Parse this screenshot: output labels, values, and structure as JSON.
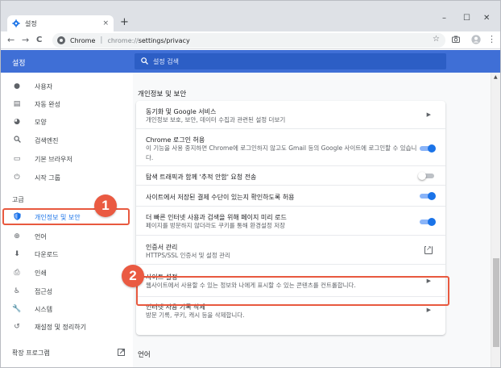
{
  "browser": {
    "tab_title": "설정",
    "tab_close": "×",
    "new_tab": "+",
    "minimize": "–",
    "maximize": "☐",
    "close": "✕",
    "back": "←",
    "forward": "→",
    "reload": "C",
    "host": "Chrome",
    "url_scheme": "chrome://",
    "url_path": "settings/privacy"
  },
  "header": {
    "title": "설정",
    "search_placeholder": "설정 검색"
  },
  "sidebar": {
    "items": [
      {
        "label": "사용자",
        "icon": "person-icon"
      },
      {
        "label": "자동 완성",
        "icon": "clipboard-icon"
      },
      {
        "label": "모양",
        "icon": "palette-icon"
      },
      {
        "label": "검색엔진",
        "icon": "search-icon"
      },
      {
        "label": "기본 브라우저",
        "icon": "browser-icon"
      },
      {
        "label": "시작 그룹",
        "icon": "power-icon"
      }
    ],
    "advanced_heading": "고급",
    "advanced_items": [
      {
        "label": "개인정보 및 보안",
        "icon": "shield-icon",
        "selected": true
      },
      {
        "label": "언어",
        "icon": "globe-icon"
      },
      {
        "label": "다운로드",
        "icon": "download-icon"
      },
      {
        "label": "인쇄",
        "icon": "printer-icon"
      },
      {
        "label": "접근성",
        "icon": "accessibility-icon"
      },
      {
        "label": "시스템",
        "icon": "wrench-icon"
      },
      {
        "label": "재설정 및 정리하기",
        "icon": "history-icon"
      }
    ],
    "extensions_label": "확장 프로그램"
  },
  "main": {
    "section_title": "개인정보 및 보안",
    "rows": [
      {
        "title": "동기화 및 Google 서비스",
        "subtitle": "개인정보 보호, 보안, 데이터 수집과 관련된 설정 더보기",
        "control": "arrow"
      },
      {
        "title": "Chrome 로그인 허용",
        "subtitle": "이 기능을 사용 중지하면 Chrome에 로그인하지 않고도 Gmail 등의 Google 사이트에 로그인할 수 있습니다.",
        "control": "toggle",
        "on": true
      },
      {
        "title": "탐색 트래픽과 함께 '추적 안함' 요청 전송",
        "control": "toggle",
        "on": false
      },
      {
        "title": "사이트에서 저장된 결제 수단이 있는지 확인하도록 허용",
        "control": "toggle",
        "on": true
      },
      {
        "title": "더 빠른 인터넷 사용과 검색을 위해 페이지 미리 로드",
        "subtitle": "페이지를 방문하지 않더라도 쿠키를 통해 환경설정 저장",
        "control": "toggle",
        "on": true
      },
      {
        "title": "인증서 관리",
        "subtitle": "HTTPS/SSL 인증서 및 설정 관리",
        "control": "external"
      },
      {
        "title": "사이트 설정",
        "subtitle": "웹사이트에서 사용할 수 있는 정보와 나에게 표시할 수 있는 콘텐츠를 컨트롤합니다.",
        "control": "arrow"
      },
      {
        "title": "인터넷 사용 기록 삭제",
        "subtitle": "방문 기록, 쿠키, 캐시 등을 삭제합니다.",
        "control": "arrow"
      }
    ],
    "language_title": "언어"
  },
  "annotations": {
    "badge_1": "1",
    "badge_2": "2"
  },
  "colors": {
    "header_blue": "#3f6fd6",
    "accent_blue": "#1a73e8",
    "highlight_red": "#e8593f"
  }
}
